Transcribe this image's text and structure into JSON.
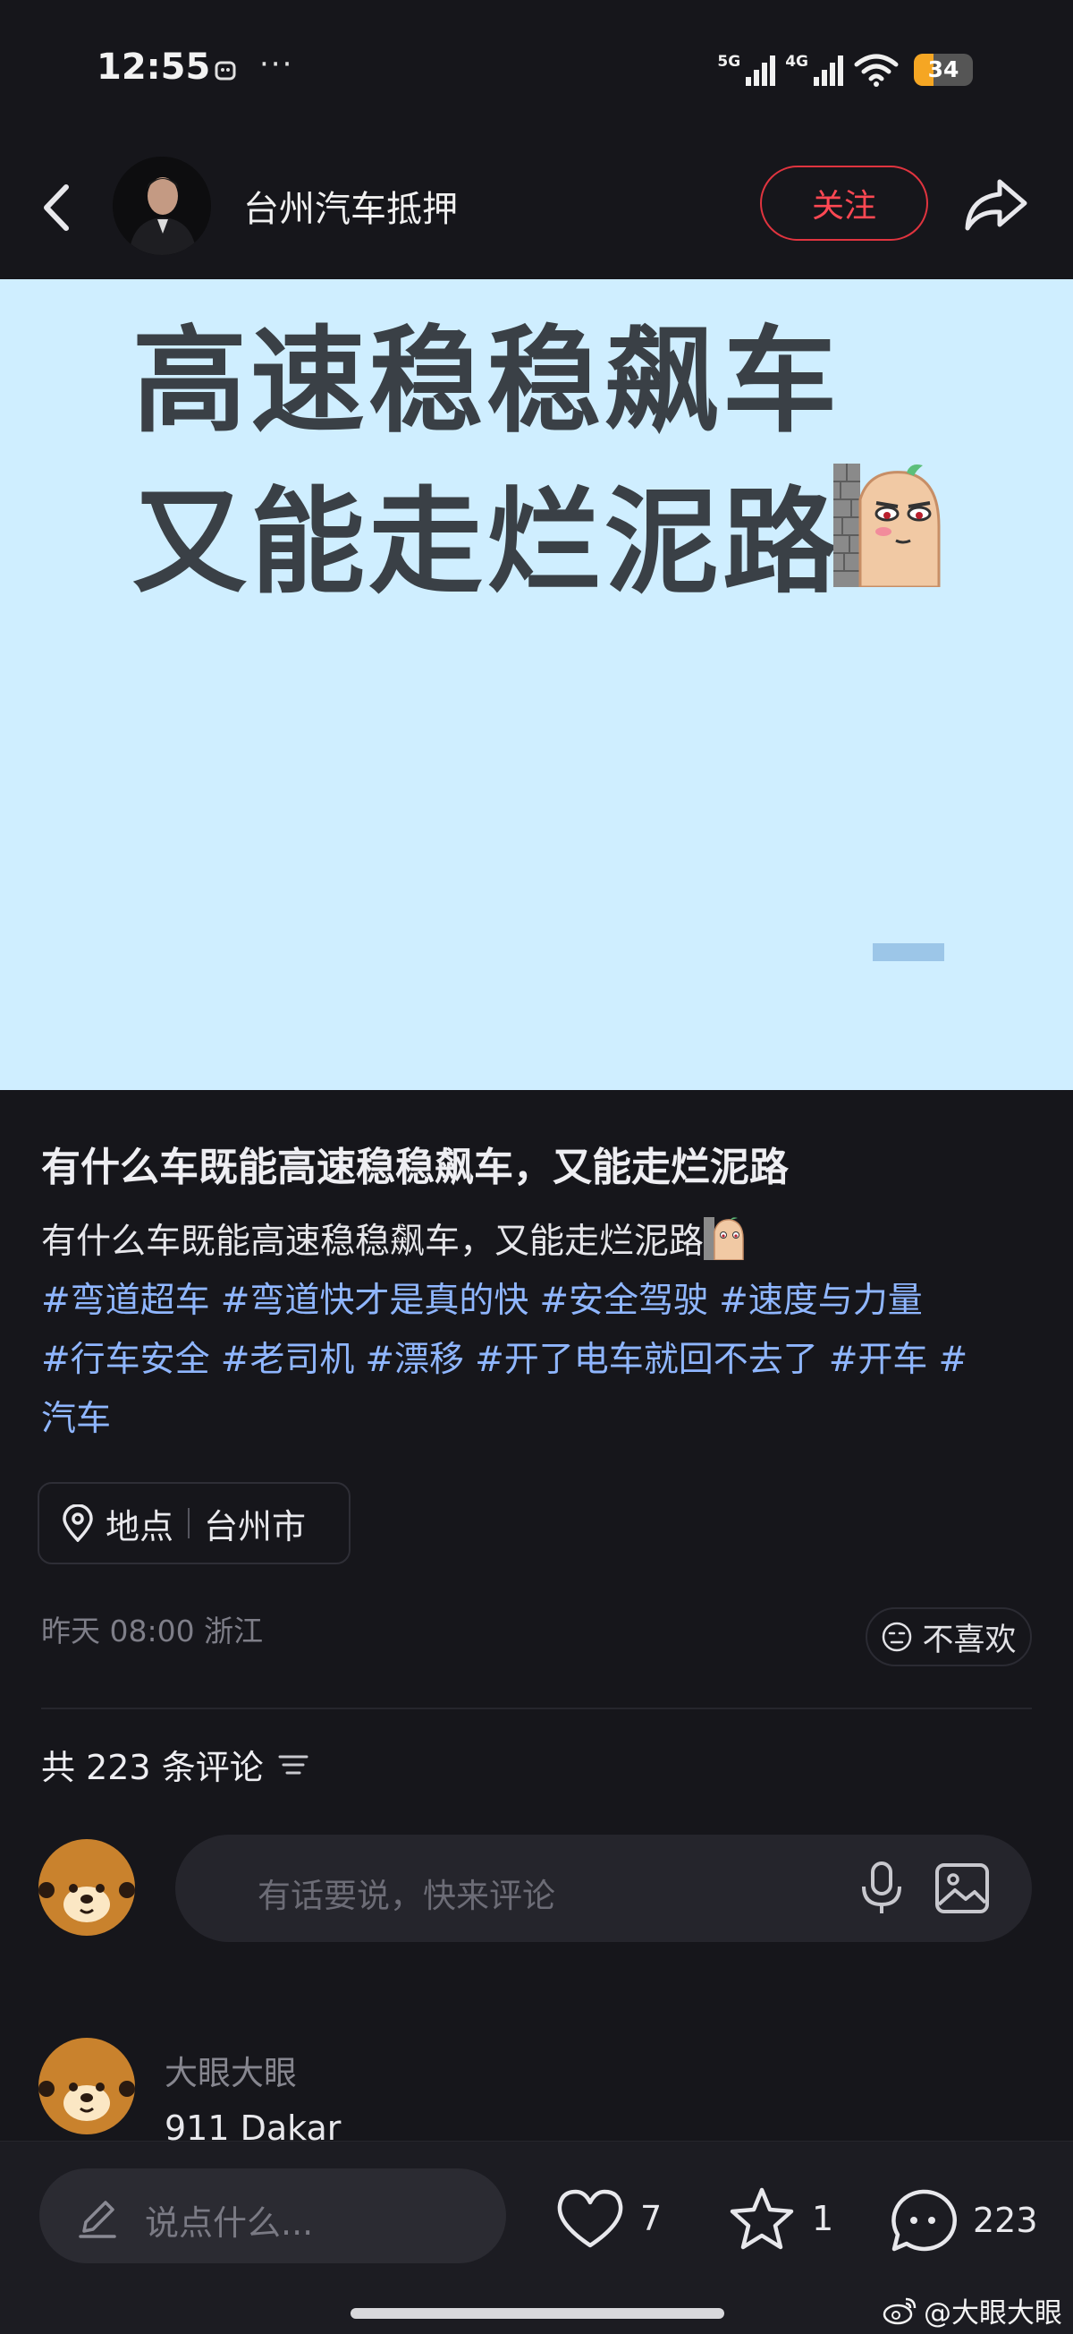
{
  "status_bar": {
    "time": "12:55",
    "dots": "···",
    "net1": "5G",
    "net2": "4G",
    "battery": "34",
    "battery_level": 0.34
  },
  "header": {
    "author_name": "台州汽车抵押",
    "follow_label": "关注"
  },
  "cover": {
    "line1_a": "高速稳稳",
    "line1_b": "飙车",
    "line2": "又能走烂泥路"
  },
  "post": {
    "title": "有什么车既能高速稳稳飙车，又能走烂泥路",
    "text": "有什么车既能高速稳稳飙车，又能走烂泥路",
    "tags": [
      "#弯道超车",
      "#弯道快才是真的快",
      "#安全驾驶",
      "#速度与力量",
      "#行车安全",
      "#老司机",
      "#漂移",
      "#开了电车就回不去了",
      "#开车",
      "#",
      "汽车"
    ],
    "location_label": "地点",
    "location_value": "台州市",
    "meta": "昨天 08:00 浙江",
    "dislike_label": "不喜欢"
  },
  "comments": {
    "count_text": "共 223 条评论",
    "input_placeholder": "有话要说，快来评论",
    "items": [
      {
        "user": "大眼大眼",
        "text": "911 Dakar"
      }
    ]
  },
  "bottom_bar": {
    "say_placeholder": "说点什么...",
    "likes": "7",
    "favorites": "1",
    "comments": "223",
    "watermark": "@大眼大眼"
  },
  "colors": {
    "background": "#16161b",
    "cover_bg": "#cfeeff",
    "follow_red": "#e0343f",
    "tag_blue": "#8fb6ff",
    "highlight_pink": "#f6b8ef"
  },
  "icons": [
    "back-icon",
    "share-icon",
    "location-pin-icon",
    "meh-face-icon",
    "sort-icon",
    "mic-icon",
    "image-icon",
    "pencil-icon",
    "heart-icon",
    "star-icon",
    "comment-bubble-icon",
    "weibo-icon"
  ]
}
